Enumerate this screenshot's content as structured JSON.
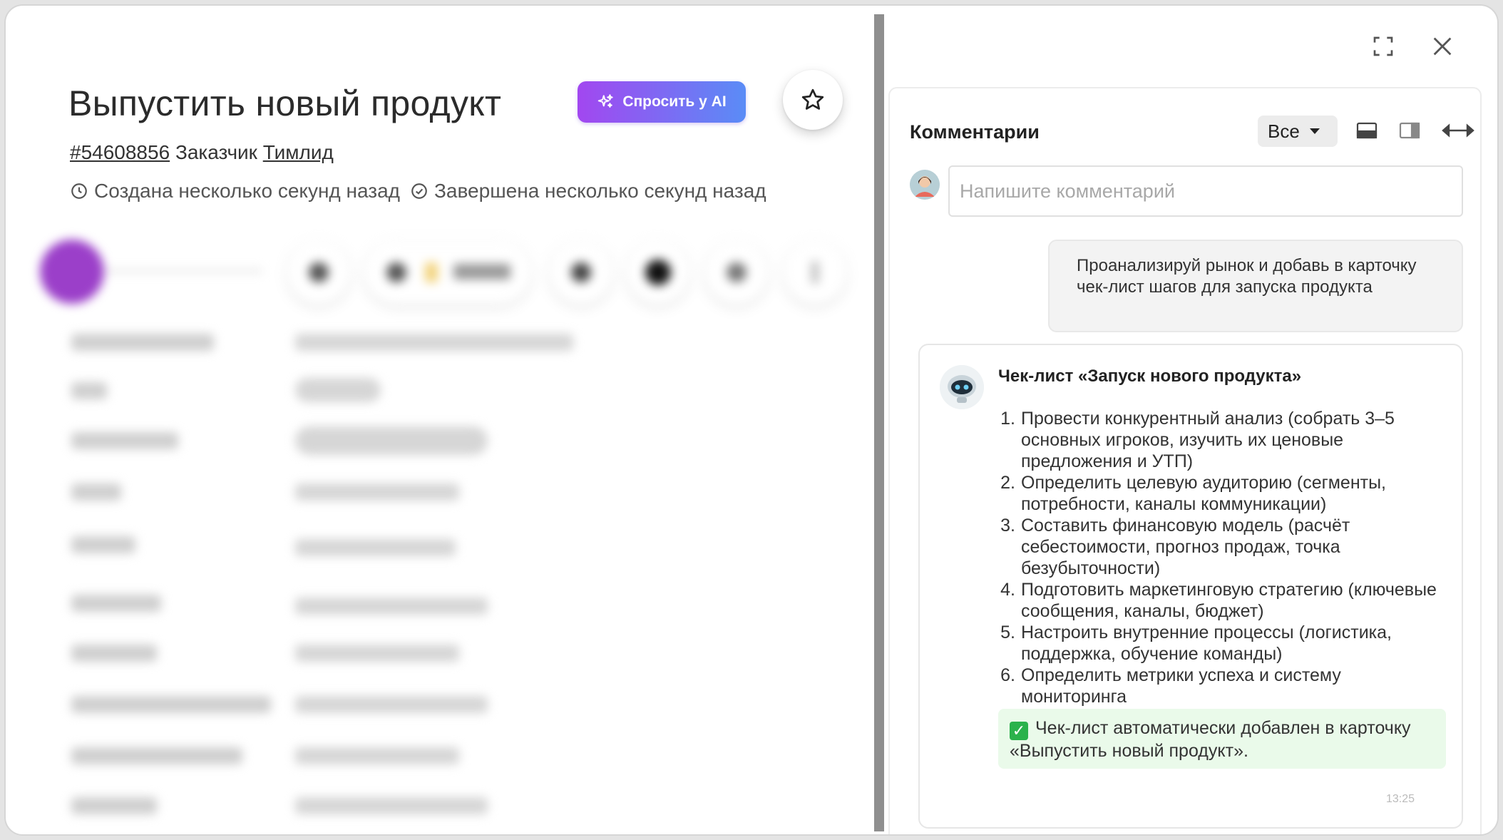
{
  "card": {
    "title": "Выпустить новый продукт",
    "ask_ai_label": "Спросить у AI",
    "id_link": "#54608856",
    "customer_label": "Заказчик",
    "customer_name": "Тимлид",
    "created_text": "Создана несколько секунд назад",
    "completed_text": "Завершена несколько секунд назад"
  },
  "comments": {
    "title": "Комментарии",
    "filter_value": "Все",
    "input_placeholder": "Напишите комментарий",
    "user_message": "Проанализируй рынок и добавь в карточку чек-лист шагов для запуска продукта",
    "ai_title": "Чек-лист «Запуск нового продукта»",
    "ai_items": [
      {
        "n": "1.",
        "text": "Провести конкурентный анализ (собрать 3–5 основных игроков, изучить их ценовые предложения и УТП)"
      },
      {
        "n": "2.",
        "text": "Определить целевую аудиторию (сегменты, потребности, каналы коммуникации)"
      },
      {
        "n": "3.",
        "text": "Составить финансовую модель (расчёт себестоимости, прогноз продаж, точка безубыточности)"
      },
      {
        "n": "4.",
        "text": "Подготовить маркетинговую стратегию (ключевые сообщения, каналы, бюджет)"
      },
      {
        "n": "5.",
        "text": "Настроить внутренние процессы (логистика, поддержка, обучение команды)"
      },
      {
        "n": "6.",
        "text": "Определить метрики успеха и систему мониторинга"
      }
    ],
    "ai_note": "Чек-лист автоматически добавлен в карточку «Выпустить новый продукт».",
    "ai_time": "13:25"
  },
  "colors": {
    "ai_gradient_start": "#a247f0",
    "ai_gradient_end": "#5a8cf6",
    "note_bg": "#eafaea",
    "check_green": "#2bb24c"
  }
}
